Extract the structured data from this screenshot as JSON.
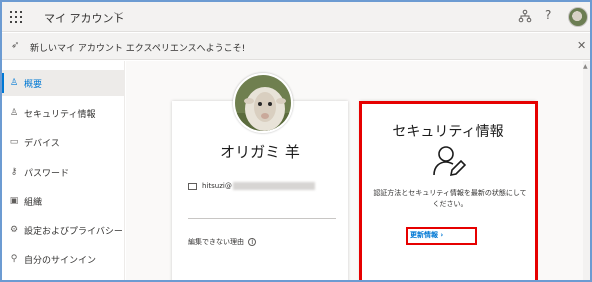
{
  "header": {
    "app_title": "マイ アカウント",
    "chevron": "﹀",
    "help": "?"
  },
  "banner": {
    "text": "新しいマイ アカウント エクスペリエンスへようこそ!",
    "close": "✕"
  },
  "sidebar": {
    "items": [
      {
        "label": "概要",
        "icon": "person-icon",
        "glyph": "♙"
      },
      {
        "label": "セキュリティ情報",
        "icon": "security-info-icon",
        "glyph": "♙"
      },
      {
        "label": "デバイス",
        "icon": "laptop-icon",
        "glyph": "▭"
      },
      {
        "label": "パスワード",
        "icon": "key-icon",
        "glyph": "⚷"
      },
      {
        "label": "組織",
        "icon": "briefcase-icon",
        "glyph": "▣"
      },
      {
        "label": "設定およびプライバシー",
        "icon": "gear-icon",
        "glyph": "⚙"
      },
      {
        "label": "自分のサインイン",
        "icon": "sign-in-icon",
        "glyph": "⚲"
      }
    ]
  },
  "profile": {
    "name": "オリガミ 羊",
    "email_prefix": "hitsuzi@",
    "cannot_edit": "編集できない理由",
    "info": "i"
  },
  "security": {
    "title": "セキュリティ情報",
    "description": "認証方法とセキュリティ情報を最新の状態にしてください。",
    "link": "更新情報 ›"
  },
  "colors": {
    "accent": "#0078d4",
    "highlight": "#e60000",
    "frame": "#6c9bd2"
  }
}
